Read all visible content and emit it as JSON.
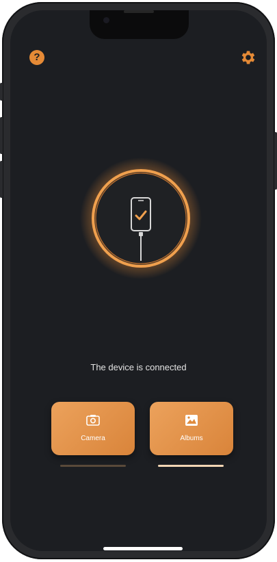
{
  "status": {
    "message": "The device is connected"
  },
  "top_bar": {
    "help_icon": "help-icon",
    "help_glyph": "?",
    "settings_icon": "gear-icon"
  },
  "connection_graphic": {
    "icon": "phone-connected-icon",
    "status_icon": "checkmark-icon"
  },
  "actions": [
    {
      "label": "Camera",
      "icon": "camera-icon",
      "selected": false
    },
    {
      "label": "Albums",
      "icon": "image-icon",
      "selected": true
    }
  ],
  "colors": {
    "accent": "#e58a36",
    "tile_gradient_start": "#eca25c",
    "tile_gradient_end": "#d9843a",
    "background": "#1c1e22",
    "selected_underline": "#f3d6b4",
    "unselected_underline": "#5a4a3a"
  }
}
